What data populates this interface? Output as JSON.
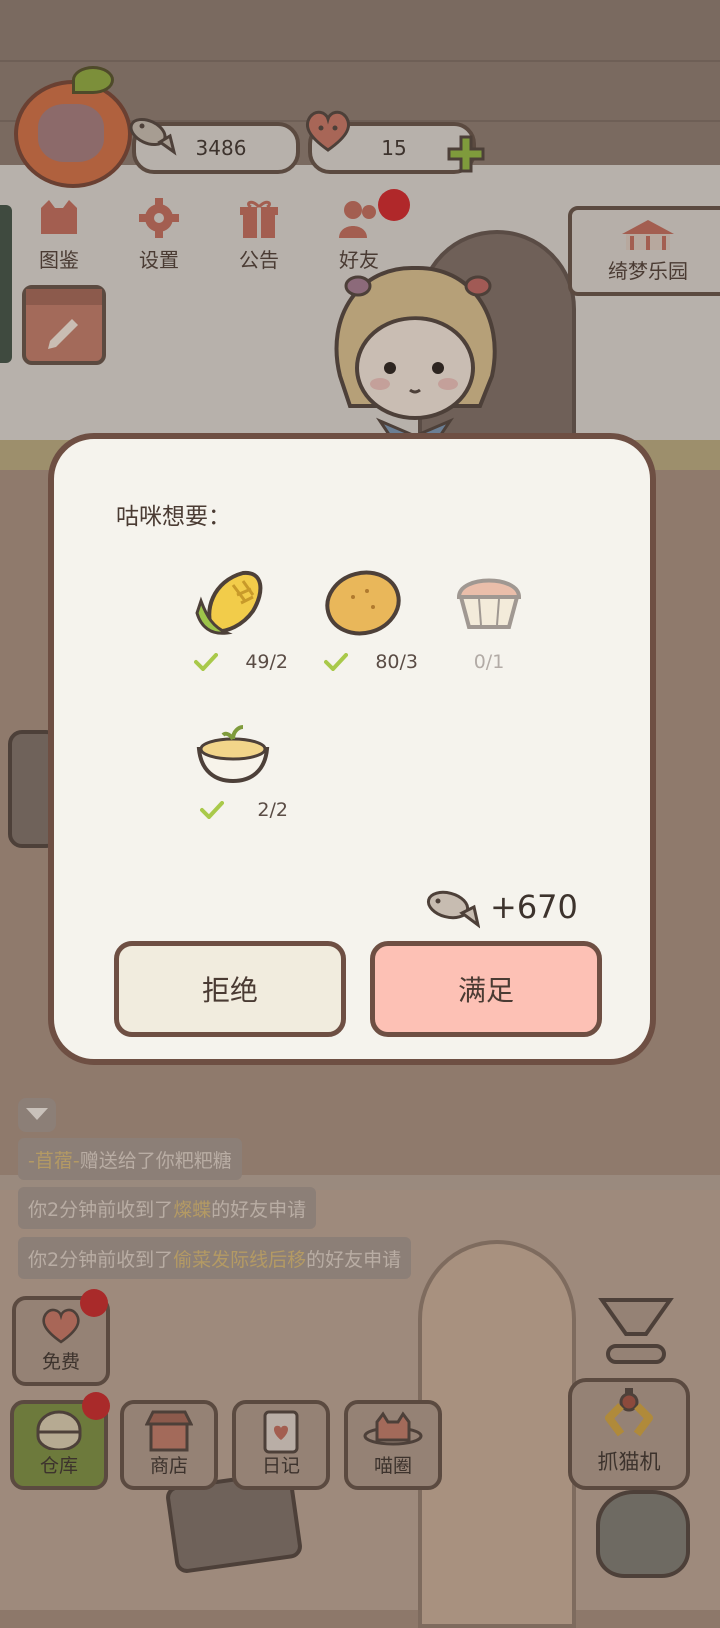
{
  "hud": {
    "fish_count": "3486",
    "heart_count": "15"
  },
  "menu": {
    "items": [
      {
        "label": "图鉴",
        "icon": "cat-head-icon"
      },
      {
        "label": "设置",
        "icon": "gear-icon"
      },
      {
        "label": "公告",
        "icon": "gift-icon"
      },
      {
        "label": "好友",
        "icon": "friends-icon"
      }
    ]
  },
  "banner": {
    "label": "绮梦乐园"
  },
  "notices": [
    {
      "pre": "",
      "hl": "-苜蓿-",
      "post": "赠送给了你粑粑糖"
    },
    {
      "pre": "你2分钟前收到了",
      "hl": "燦蝶",
      "post": "的好友申请"
    },
    {
      "pre": "你2分钟前收到了",
      "hl": "偷菜发际线后移",
      "post": "的好友申请"
    }
  ],
  "bottom": {
    "free": "免费",
    "warehouse": "仓库",
    "shop": "商店",
    "diary": "日记",
    "circle": "喵圈",
    "claw": "抓猫机"
  },
  "modal": {
    "title": "咕咪想要：",
    "items": [
      {
        "name": "corn",
        "count": "49/2",
        "met": true
      },
      {
        "name": "potato",
        "count": "80/3",
        "met": true
      },
      {
        "name": "cupcake",
        "count": "0/1",
        "met": false
      },
      {
        "name": "mashed-potato",
        "count": "2/2",
        "met": true
      }
    ],
    "reward": "+670",
    "refuse_label": "拒绝",
    "accept_label": "满足"
  },
  "colors": {
    "accept": "#fdc1b5",
    "refuse": "#f1ecde",
    "check": "#a9c94a"
  }
}
